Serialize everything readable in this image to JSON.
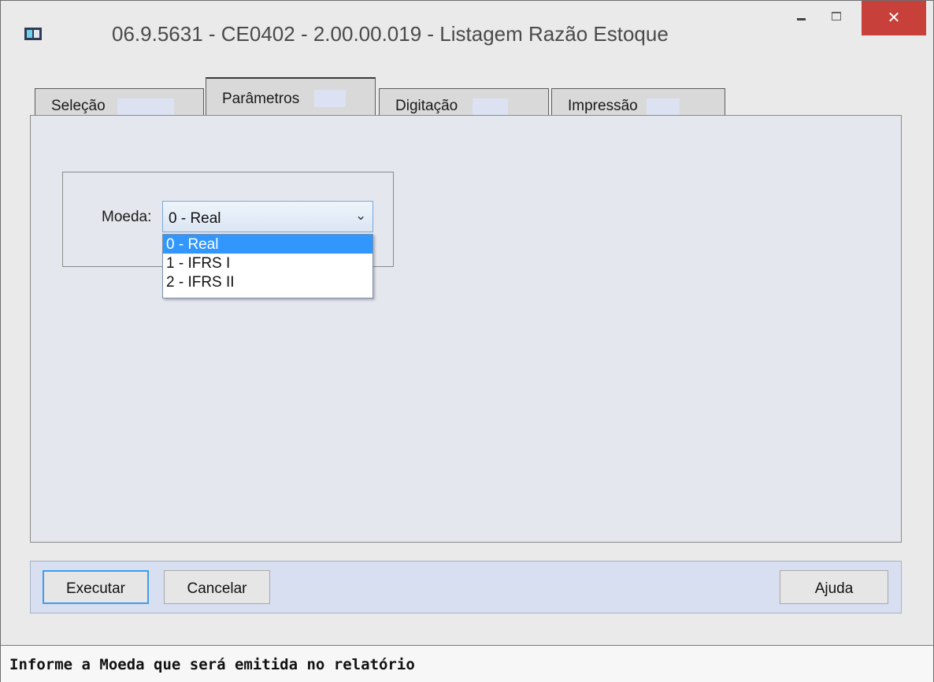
{
  "window": {
    "title": "06.9.5631 - CE0402 - 2.00.00.019 - Listagem Razão Estoque",
    "close_glyph": "✕",
    "app_icon": "window-app-icon",
    "minimize_icon": "minimize-icon",
    "maximize_icon": "maximize-icon"
  },
  "tabs": [
    {
      "label": "Seleção",
      "active": false
    },
    {
      "label": "Parâmetros",
      "active": true
    },
    {
      "label": "Digitação",
      "active": false
    },
    {
      "label": "Impressão",
      "active": false
    }
  ],
  "moeda": {
    "label": "Moeda:",
    "value": "0 - Real",
    "arrow_glyph": "⌄",
    "options": [
      "0 - Real",
      "1 - IFRS I",
      "2 - IFRS II"
    ],
    "selected_index": 0
  },
  "buttons": {
    "execute": "Executar",
    "cancel": "Cancelar",
    "help": "Ajuda"
  },
  "status": {
    "text": "Informe a Moeda que será emitida no relatório"
  },
  "colors": {
    "close_button": "#c7403a",
    "selected_option": "#3297fd",
    "panel_background": "#e5e7ee",
    "focus_border": "#3d9dee"
  }
}
